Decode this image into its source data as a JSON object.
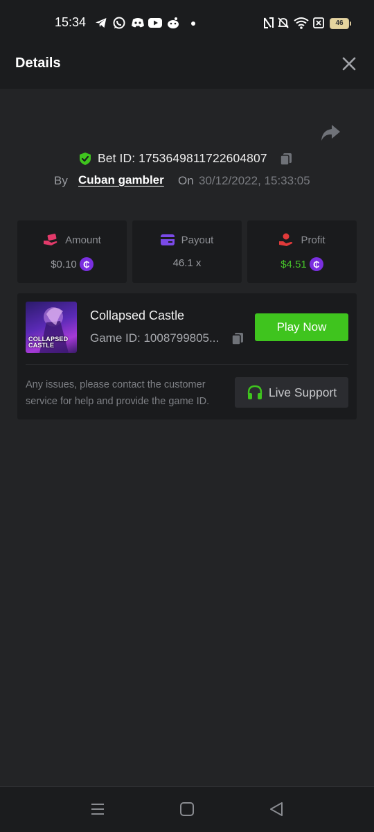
{
  "status_bar": {
    "time": "15:34",
    "icons": [
      "telegram-icon",
      "whatsapp-icon",
      "discord-icon",
      "youtube-icon",
      "reddit-icon",
      "dot-icon",
      "nfc-icon",
      "mute-icon",
      "wifi-icon",
      "sim-off-icon"
    ],
    "battery": "46"
  },
  "header": {
    "title": "Details",
    "close_icon": "close-icon"
  },
  "bet": {
    "share_icon": "share-icon",
    "id_label": "Bet ID: 1753649811722604807",
    "by_label": "By",
    "username": "Cuban gambler",
    "on_label": "On",
    "date": "30/12/2022, 15:33:05"
  },
  "stats": {
    "amount": {
      "label": "Amount",
      "value": "$0.10",
      "icon": "hand-money-icon"
    },
    "payout": {
      "label": "Payout",
      "value": "46.1 x",
      "icon": "card-icon"
    },
    "profit": {
      "label": "Profit",
      "value": "$4.51",
      "icon": "hand-coin-icon"
    },
    "coin_symbol": "₵"
  },
  "game": {
    "name": "Collapsed Castle",
    "id_label": "Game ID: 1008799805...",
    "thumb_title_1": "COLLAPSED",
    "thumb_title_2": "CASTLE",
    "play_label": "Play Now",
    "support_note": "Any issues, please contact the customer service for help and provide the game ID.",
    "support_label": "Live Support"
  },
  "colors": {
    "accent_green": "#3fc41e",
    "profit_green": "#46c32a",
    "coin_purple": "#7a2fe0",
    "background": "#232426",
    "card": "#1a1b1d"
  },
  "nav": [
    "recents-icon",
    "home-icon",
    "back-icon"
  ]
}
